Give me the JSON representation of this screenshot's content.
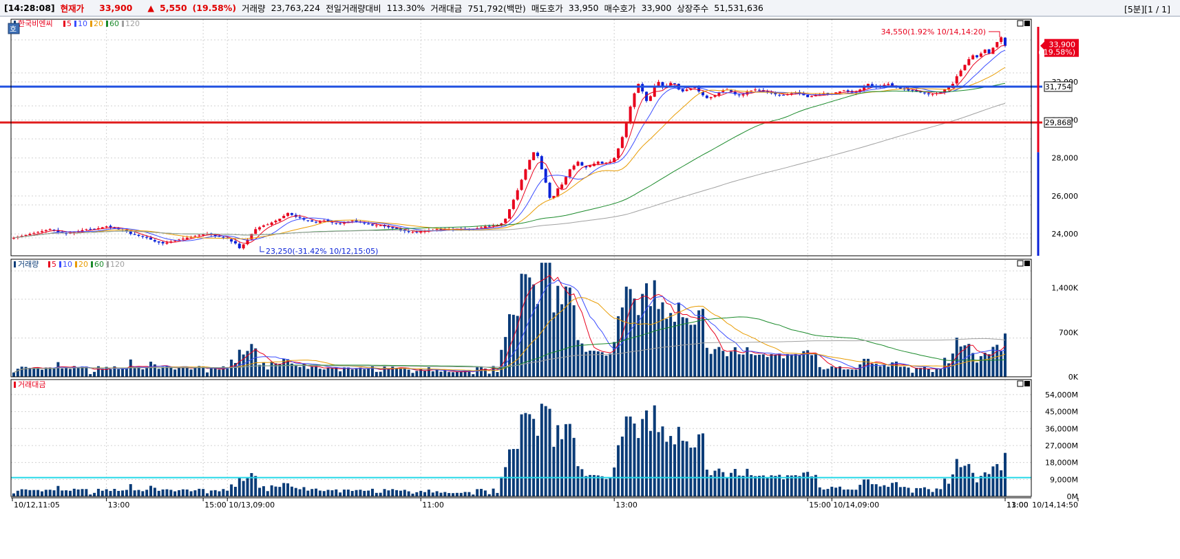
{
  "header": {
    "time": "[14:28:08]",
    "current_label": "현재가",
    "current_price": "33,900",
    "change_arrow": "▲",
    "change": "5,550",
    "change_pct": "(19.58%)",
    "volume_label": "거래량",
    "volume": "23,763,224",
    "prev_volume_ratio_label": "전일거래량대비",
    "prev_volume_ratio": "113.30%",
    "trade_amount_label": "거래대금",
    "trade_amount": "751,792(백만)",
    "ask_label": "매도호가",
    "ask": "33,950",
    "bid_label": "매수호가",
    "bid": "33,900",
    "shares_label": "상장주수",
    "shares": "51,531,636",
    "period": "[5분][1 / 1]"
  },
  "colors": {
    "up": "#e8001c",
    "down": "#0a22d8",
    "ma5": "#e8001c",
    "ma10": "#3a4cff",
    "ma20": "#e89b00",
    "ma60": "#1a8a2a",
    "ma120": "#a0a0a0",
    "volume_bar": "#0b3c78",
    "hline_blue": "#1f4fe0",
    "hline_red": "#e01a1a",
    "cyan": "#22d8e8"
  },
  "price_panel": {
    "side_tab": "호",
    "legend_name": "한국비엔씨",
    "legend_periods": [
      "5",
      "10",
      "20",
      "60",
      "120"
    ],
    "y_ticks": [
      "24,000",
      "26,000",
      "28,000",
      "30,000",
      "32,000"
    ],
    "y_tick_values": [
      24000,
      26000,
      28000,
      30000,
      32000
    ],
    "y_range": [
      22850,
      35300
    ],
    "current_tag_price": "33,900",
    "current_tag_pct": "( 19.58%)",
    "current_value": 33900,
    "hline_blue_label": "31,754",
    "hline_blue_value": 31754,
    "hline_red_label": "29,868",
    "hline_red_value": 29868,
    "high_annotation": "34,550(1.92% 10/14,14:20)",
    "low_annotation": "23,250(-31.42% 10/12,15:05)"
  },
  "volume_panel": {
    "legend_name": "거래량",
    "legend_periods": [
      "5",
      "10",
      "20",
      "60",
      "120"
    ],
    "y_ticks": [
      "0K",
      "700K",
      "1,400K"
    ],
    "y_tick_values": [
      0,
      700000,
      1400000
    ],
    "y_max": 1850000
  },
  "amount_panel": {
    "legend_name": "거래대금",
    "y_ticks": [
      "0M",
      "9,000M",
      "18,000M",
      "27,000M",
      "36,000M",
      "45,000M",
      "54,000M"
    ],
    "y_tick_values": [
      0,
      9000,
      18000,
      27000,
      36000,
      45000,
      54000
    ],
    "y_max": 62000,
    "reference_value": 10000
  },
  "x_axis": {
    "labels": [
      "10/12,11:05",
      "13:00",
      "15:00",
      "10/13,09:00",
      "11:00",
      "13:00",
      "15:00",
      "10/14,09:00",
      "11:00",
      "13:00",
      "10/14,14:50"
    ]
  },
  "chart_data": {
    "type": "candlestick",
    "title": "한국비엔씨",
    "periods": [
      "5",
      "10",
      "20",
      "60",
      "120"
    ],
    "close": [
      23800,
      23850,
      23900,
      23950,
      24000,
      24050,
      24100,
      24150,
      24200,
      24250,
      24200,
      24100,
      24050,
      24000,
      24050,
      24100,
      24150,
      24200,
      24250,
      24250,
      24250,
      24300,
      24350,
      24400,
      24350,
      24300,
      24250,
      24200,
      24150,
      24000,
      23950,
      23900,
      23850,
      23800,
      23700,
      23600,
      23550,
      23500,
      23550,
      23600,
      23650,
      23700,
      23750,
      23800,
      23850,
      23900,
      23950,
      24000,
      24000,
      23950,
      23900,
      23850,
      23800,
      23750,
      23600,
      23500,
      23250,
      23450,
      23700,
      24000,
      24250,
      24350,
      24450,
      24500,
      24600,
      24700,
      24800,
      24950,
      25100,
      25000,
      24900,
      24850,
      24750,
      24700,
      24650,
      24600,
      24650,
      24700,
      24650,
      24600,
      24550,
      24550,
      24600,
      24650,
      24700,
      24650,
      24600,
      24550,
      24500,
      24450,
      24450,
      24450,
      24400,
      24350,
      24300,
      24250,
      24200,
      24150,
      24100,
      24100,
      24100,
      24150,
      24150,
      24200,
      24200,
      24250,
      24250,
      24250,
      24250,
      24250,
      24250,
      24250,
      24250,
      24250,
      24250,
      24300,
      24350,
      24400,
      24400,
      24450,
      24450,
      24550,
      24800,
      25300,
      25800,
      26300,
      26850,
      27400,
      27900,
      28300,
      28100,
      27400,
      26700,
      25900,
      26000,
      26400,
      26600,
      27000,
      27400,
      27600,
      27800,
      27600,
      27500,
      27600,
      27700,
      27800,
      27700,
      27750,
      27800,
      28000,
      28500,
      29100,
      29900,
      30700,
      31400,
      31900,
      31500,
      31000,
      31250,
      31800,
      32000,
      31700,
      31800,
      31950,
      31900,
      31600,
      31500,
      31600,
      31650,
      31700,
      31500,
      31300,
      31150,
      31200,
      31300,
      31450,
      31550,
      31600,
      31500,
      31350,
      31300,
      31350,
      31500,
      31550,
      31600,
      31550,
      31500,
      31450,
      31400,
      31350,
      31300,
      31300,
      31350,
      31400,
      31450,
      31400,
      31300,
      31200,
      31250,
      31300,
      31350,
      31400,
      31350,
      31400,
      31450,
      31500,
      31550,
      31500,
      31450,
      31500,
      31600,
      31750,
      31900,
      31800,
      31700,
      31750,
      31850,
      31900,
      31800,
      31700,
      31650,
      31600,
      31550,
      31550,
      31500,
      31450,
      31400,
      31350,
      31350,
      31400,
      31450,
      31600,
      31700,
      31900,
      32300,
      32600,
      32900,
      33200,
      33400,
      33300,
      33500,
      33700,
      33500,
      33800,
      34100,
      34350,
      33900
    ],
    "volume_bars": "per-bar trading volume (derived, ~300 bars)",
    "note": "price series shown as 5-minute candles"
  }
}
